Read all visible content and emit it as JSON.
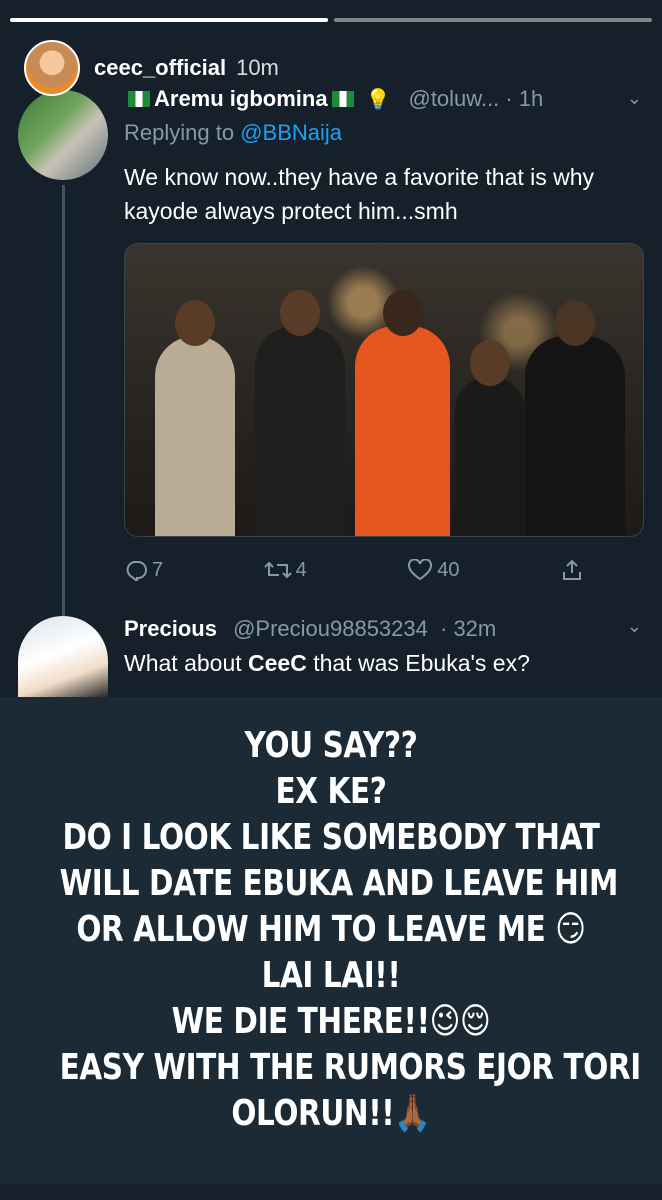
{
  "story": {
    "progress": [
      1.0,
      0.0
    ],
    "username": "ceec_official",
    "time": "10m"
  },
  "tweet1": {
    "name": "Aremu igbomina",
    "handle": "@toluw...",
    "time": "· 1h",
    "replying_prefix": "Replying to",
    "replying_to": "@BBNaija",
    "text": "We know now..they have a favorite that is why kayode always protect him...smh",
    "reply_count": "7",
    "retweet_count": "4",
    "like_count": "40"
  },
  "tweet2": {
    "name": "Precious",
    "handle": "@Preciou98853234",
    "time": "· 32m",
    "text_before": "What about ",
    "text_bold": "CeeC",
    "text_after": " that was Ebuka's ex?"
  },
  "caption": {
    "lines": [
      "YOU SAY??",
      "EX KE?",
      "DO I LOOK LIKE SOMEBODY THAT",
      "WILL DATE EBUKA AND LEAVE HIM",
      "OR ALLOW HIM TO LEAVE ME 😏",
      "LAI LAI!!",
      "WE DIE THERE!!😉😌",
      "EASY WITH THE RUMORS EJOR TORI",
      "OLORUN!!🙏🏾"
    ]
  }
}
